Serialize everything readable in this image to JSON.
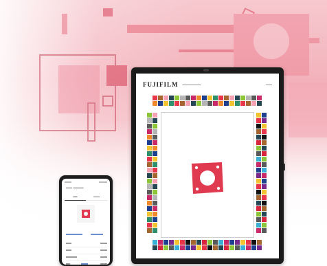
{
  "tablet": {
    "brand": "FUJIFILM",
    "screen_color": "#ffffff",
    "sample_color": "#e03a50"
  },
  "phone": {
    "screen_color": "#ffffff",
    "sample_color": "#e13b52"
  },
  "palette": [
    "#e8364b",
    "#2e8f6b",
    "#f2c230",
    "#7a2a8c",
    "#1f3f8f",
    "#ef8a2c",
    "#c92a6a",
    "#3bb0d6",
    "#5a5a5a",
    "#b5b5b5",
    "#8cc43a",
    "#d7263d",
    "#264653",
    "#f4a3b4",
    "#a5672f",
    "#111111"
  ],
  "colors": {
    "background": "#f3b2bb",
    "device_frame": "#1b1b1b"
  }
}
